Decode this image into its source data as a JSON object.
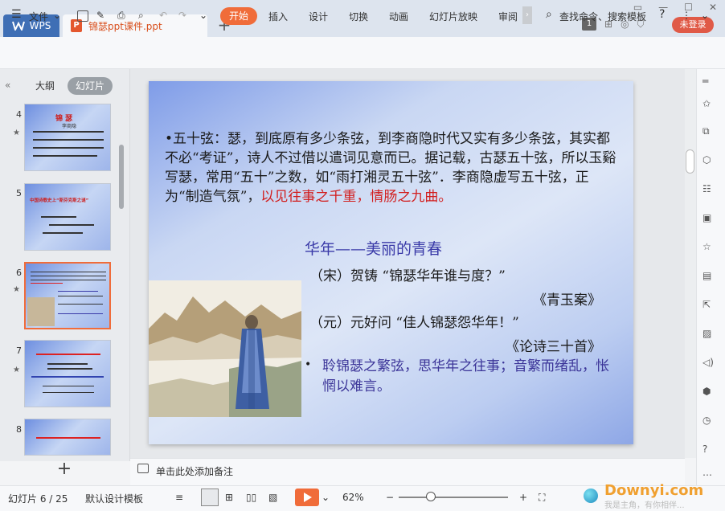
{
  "titlebar": {
    "app_tab": "WPS",
    "doc_tab": "锦瑟ppt课件.ppt",
    "badge": "1",
    "login": "未登录"
  },
  "toolbar": {
    "file": "文件",
    "start": "开始",
    "insert": "插入",
    "design": "设计",
    "switch": "切换",
    "animation": "动画",
    "slideshow": "幻灯片放映",
    "review": "审阅",
    "search": "查找命令、搜索模板"
  },
  "panel": {
    "tab_outline": "大纲",
    "tab_slides": "幻灯片",
    "thumbs": [
      {
        "num": "4",
        "title": "锦 瑟",
        "sub": "李商隐"
      },
      {
        "num": "5",
        "title": "中国诗歌史上“斯芬克斯之谜”"
      },
      {
        "num": "6"
      },
      {
        "num": "7"
      },
      {
        "num": "8"
      }
    ]
  },
  "slide": {
    "para1_main": "•五十弦：瑟，到底原有多少条弦，到李商隐时代又实有多少条弦，其实都不必“考证”，诗人不过借以遣词见意而已。据记载，古瑟五十弦，所以玉谿写瑟，常用“五十”之数，如“雨打湘灵五十弦”．李商隐虚写五十弦，正为“制造气氛”，",
    "para1_red": "以见往事之千重，情肠之九曲。",
    "subtitle": "华年——美丽的青春",
    "quote1": "（宋）贺铸 “锦瑟华年谁与度？”",
    "source1": "《青玉案》",
    "quote2": "（元）元好问 “佳人锦瑟怨华年！”",
    "source2": "《论诗三十首》",
    "bullet": "•",
    "para2": "聆锦瑟之繁弦，思华年之往事；音繁而绪乱，怅惘以难言。"
  },
  "notes": {
    "placeholder": "单击此处添加备注"
  },
  "status": {
    "slide_count": "幻灯片 6 / 25",
    "template": "默认设计模板",
    "zoom": "62%",
    "watermark": "Downyi.com",
    "watermark_sub": "我是主角，有你相伴..."
  },
  "colors": {
    "accent": "#f06c3a",
    "wps_blue": "#3f6fb5",
    "login_red": "#e05a47"
  }
}
